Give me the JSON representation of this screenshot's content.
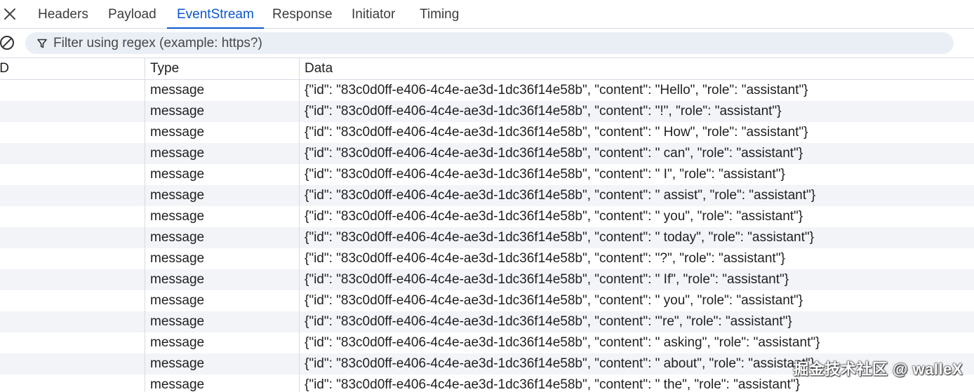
{
  "tabs": [
    {
      "label": "Headers",
      "active": false
    },
    {
      "label": "Payload",
      "active": false
    },
    {
      "label": "EventStream",
      "active": true
    },
    {
      "label": "Response",
      "active": false
    },
    {
      "label": "Initiator",
      "active": false
    },
    {
      "label": "Timing",
      "active": false
    }
  ],
  "filter": {
    "placeholder": "Filter using regex (example: https?)",
    "value": ""
  },
  "table": {
    "headers": {
      "id": "ID",
      "type": "Type",
      "data": "Data"
    },
    "rows": [
      {
        "id": "",
        "type": "message",
        "data": "{\"id\": \"83c0d0ff-e406-4c4e-ae3d-1dc36f14e58b\", \"content\": \"Hello\", \"role\": \"assistant\"}"
      },
      {
        "id": "",
        "type": "message",
        "data": "{\"id\": \"83c0d0ff-e406-4c4e-ae3d-1dc36f14e58b\", \"content\": \"!\", \"role\": \"assistant\"}"
      },
      {
        "id": "",
        "type": "message",
        "data": "{\"id\": \"83c0d0ff-e406-4c4e-ae3d-1dc36f14e58b\", \"content\": \" How\", \"role\": \"assistant\"}"
      },
      {
        "id": "",
        "type": "message",
        "data": "{\"id\": \"83c0d0ff-e406-4c4e-ae3d-1dc36f14e58b\", \"content\": \" can\", \"role\": \"assistant\"}"
      },
      {
        "id": "",
        "type": "message",
        "data": "{\"id\": \"83c0d0ff-e406-4c4e-ae3d-1dc36f14e58b\", \"content\": \" I\", \"role\": \"assistant\"}"
      },
      {
        "id": "",
        "type": "message",
        "data": "{\"id\": \"83c0d0ff-e406-4c4e-ae3d-1dc36f14e58b\", \"content\": \" assist\", \"role\": \"assistant\"}"
      },
      {
        "id": "",
        "type": "message",
        "data": "{\"id\": \"83c0d0ff-e406-4c4e-ae3d-1dc36f14e58b\", \"content\": \" you\", \"role\": \"assistant\"}"
      },
      {
        "id": "",
        "type": "message",
        "data": "{\"id\": \"83c0d0ff-e406-4c4e-ae3d-1dc36f14e58b\", \"content\": \" today\", \"role\": \"assistant\"}"
      },
      {
        "id": "",
        "type": "message",
        "data": "{\"id\": \"83c0d0ff-e406-4c4e-ae3d-1dc36f14e58b\", \"content\": \"?\", \"role\": \"assistant\"}"
      },
      {
        "id": "",
        "type": "message",
        "data": "{\"id\": \"83c0d0ff-e406-4c4e-ae3d-1dc36f14e58b\", \"content\": \" If\", \"role\": \"assistant\"}"
      },
      {
        "id": "",
        "type": "message",
        "data": "{\"id\": \"83c0d0ff-e406-4c4e-ae3d-1dc36f14e58b\", \"content\": \" you\", \"role\": \"assistant\"}"
      },
      {
        "id": "",
        "type": "message",
        "data": "{\"id\": \"83c0d0ff-e406-4c4e-ae3d-1dc36f14e58b\", \"content\": \"'re\", \"role\": \"assistant\"}"
      },
      {
        "id": "",
        "type": "message",
        "data": "{\"id\": \"83c0d0ff-e406-4c4e-ae3d-1dc36f14e58b\", \"content\": \" asking\", \"role\": \"assistant\"}"
      },
      {
        "id": "",
        "type": "message",
        "data": "{\"id\": \"83c0d0ff-e406-4c4e-ae3d-1dc36f14e58b\", \"content\": \" about\", \"role\": \"assistant\"}"
      },
      {
        "id": "",
        "type": "message",
        "data": "{\"id\": \"83c0d0ff-e406-4c4e-ae3d-1dc36f14e58b\", \"content\": \" the\", \"role\": \"assistant\"}"
      }
    ]
  },
  "watermark": "掘金技术社区 @ walleX",
  "icons": {
    "close": "close-icon",
    "clear": "clear-icon",
    "filter": "filter-icon"
  },
  "colors": {
    "accent": "#0b57d0",
    "filter_bg": "#eaeff6",
    "row_alt": "#f2f4f8",
    "border": "#d6dbe3"
  }
}
